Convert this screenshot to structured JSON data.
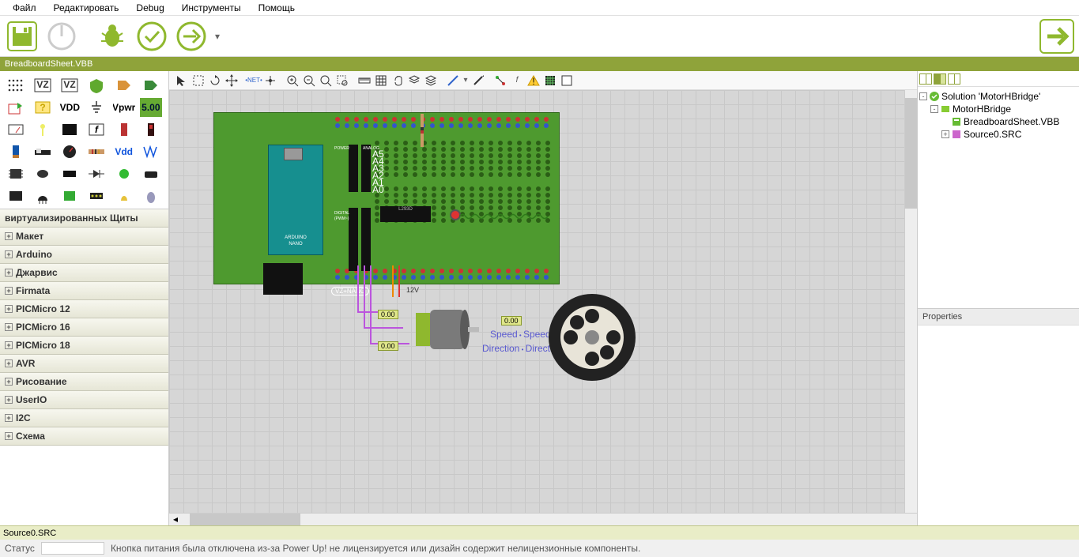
{
  "menu": {
    "file": "Файл",
    "edit": "Редактировать",
    "debug": "Debug",
    "tools": "Инструменты",
    "help": "Помощь"
  },
  "tab": {
    "title": "BreadboardSheet.VBB"
  },
  "palette_labels": {
    "vdd": "VDD",
    "vpwr": "Vpwr",
    "val500": "5.00",
    "vdd2": "Vdd"
  },
  "categories": [
    "виртуализированных Щиты",
    "Макет",
    "Arduino",
    "Джарвис",
    "Firmata",
    "PICMicro 12",
    "PICMicro 16",
    "PICMicro 18",
    "AVR",
    "Рисование",
    "UserIO",
    "I2C",
    "Схема"
  ],
  "tree": {
    "solution": "Solution 'MotorHBridge'",
    "project": "MotorHBridge",
    "sheet": "BreadboardSheet.VBB",
    "source": "Source0.SRC"
  },
  "props": {
    "title": "Properties"
  },
  "bottom": {
    "tab": "Source0.SRC"
  },
  "status": {
    "label": "Статус",
    "msg": "Кнопка питания была отключена из-за Power Up! не лицензируется или дизайн содержит нелицензионные компоненты."
  },
  "schem": {
    "nano": "VZ+NANO",
    "volt": "12V",
    "v1": "0.00",
    "v2": "0.00",
    "v3": "0.00",
    "speed": "Speed",
    "direction": "Direction",
    "arduinoName": "ARDUINO",
    "nanoName": "NANO",
    "pins": [
      "A5",
      "A4",
      "A3",
      "A2",
      "A1",
      "A0"
    ],
    "power": "POWER",
    "analog": "ANALOG",
    "digital": "DIGITAL",
    "pwm": "(PWM~)",
    "chip": "L293D"
  }
}
